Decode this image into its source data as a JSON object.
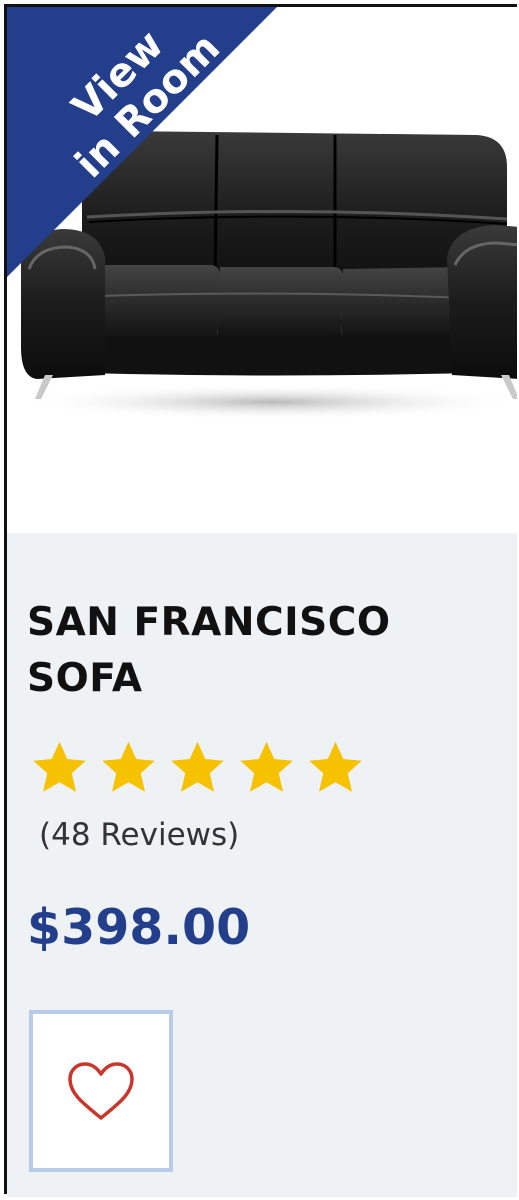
{
  "product": {
    "badge": [
      "View",
      "in Room"
    ],
    "name": "SAN FRANCISCO SOFA",
    "rating": {
      "value": 5,
      "max": 5
    },
    "reviews": "(48 Reviews)",
    "price": "$398.00"
  },
  "colors": {
    "badge_bg": "#233f8c",
    "star": "#f6c200",
    "price": "#233f8c",
    "heart": "#c8372b",
    "info_bg": "#eff2f5"
  },
  "icons": {
    "favorite": "heart-outline-icon",
    "rating": "star-icon"
  }
}
